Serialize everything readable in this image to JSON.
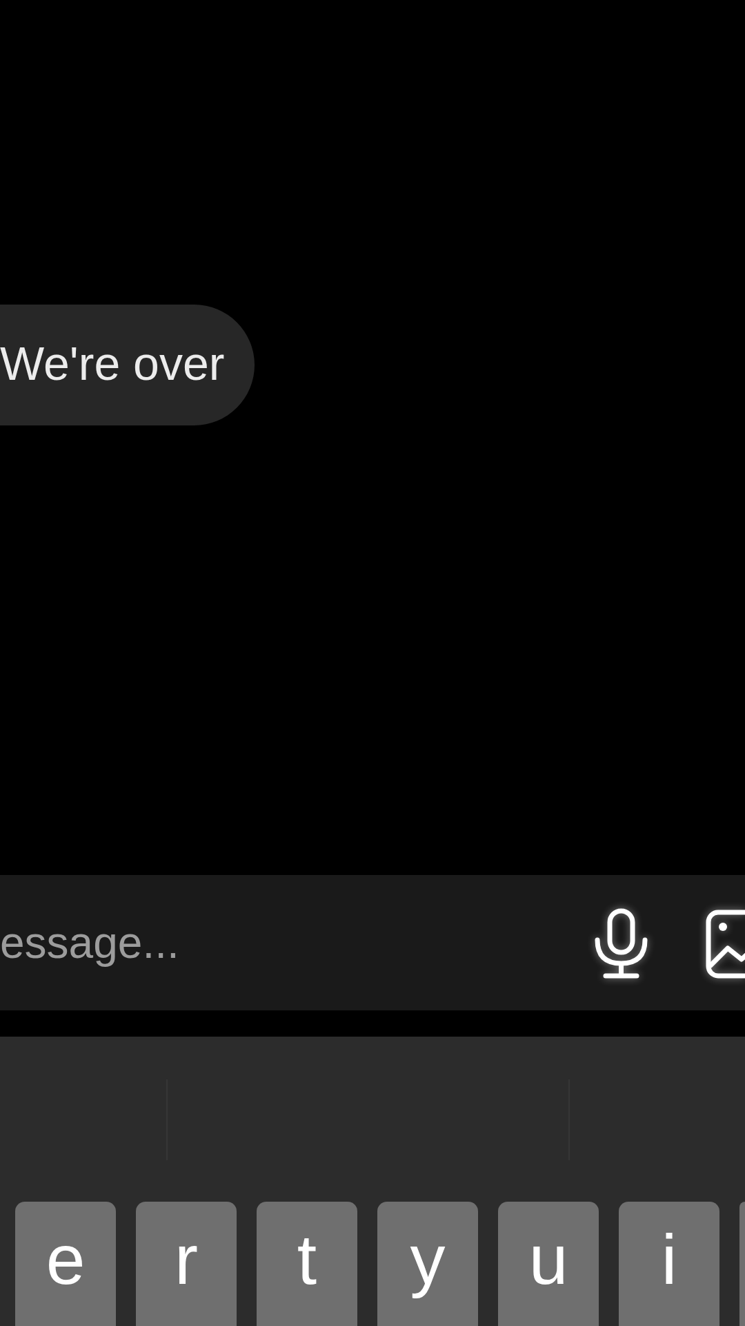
{
  "chat": {
    "messages": [
      {
        "text": "We're over"
      }
    ]
  },
  "composer": {
    "placeholder": "essage..."
  },
  "keyboard": {
    "keys": [
      {
        "kind": "letter",
        "label": "e"
      },
      {
        "kind": "letter",
        "label": "r"
      },
      {
        "kind": "letter",
        "label": "t"
      },
      {
        "kind": "letter",
        "label": "y"
      },
      {
        "kind": "letter",
        "label": "u"
      },
      {
        "kind": "letter",
        "label": "i"
      },
      {
        "kind": "partial"
      }
    ]
  }
}
